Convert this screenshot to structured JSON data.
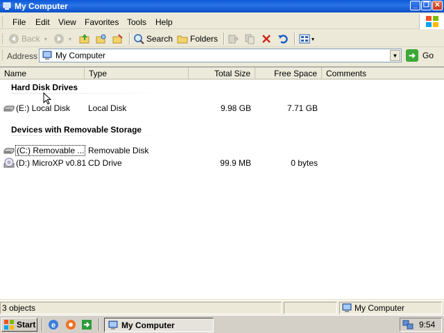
{
  "window": {
    "title": "My Computer",
    "icon": "my-computer-icon",
    "controls": [
      "minimize-icon",
      "restore-icon",
      "close-icon"
    ]
  },
  "menubar": {
    "items": [
      {
        "label": "File"
      },
      {
        "label": "Edit"
      },
      {
        "label": "View"
      },
      {
        "label": "Favorites"
      },
      {
        "label": "Tools"
      },
      {
        "label": "Help"
      }
    ],
    "logo": "windows-flag-icon"
  },
  "toolbar": {
    "back_label": "Back",
    "search_label": "Search",
    "folders_label": "Folders",
    "icons": [
      "back-icon",
      "forward-icon",
      "up-folder-icon",
      "search-icon",
      "folders-icon",
      "move-to-icon",
      "copy-to-icon",
      "delete-icon",
      "undo-icon",
      "views-icon"
    ]
  },
  "address": {
    "label": "Address",
    "value": "My Computer",
    "go_label": "Go"
  },
  "columns": {
    "name": "Name",
    "type": "Type",
    "total_size": "Total Size",
    "free_space": "Free Space",
    "comments": "Comments"
  },
  "groups": [
    {
      "title": "Hard Disk Drives",
      "items": [
        {
          "name": "(E:) Local Disk",
          "type": "Local Disk",
          "total_size": "9.98 GB",
          "free_space": "7.71 GB",
          "icon": "hard-disk-icon"
        }
      ]
    },
    {
      "title": "Devices with Removable Storage",
      "items": [
        {
          "name": "(C:) Removable ...",
          "type": "Removable Disk",
          "total_size": "",
          "free_space": "",
          "icon": "removable-disk-icon"
        },
        {
          "name": "(D:) MicroXP v0.81",
          "type": "CD Drive",
          "total_size": "99.9 MB",
          "free_space": "0 bytes",
          "icon": "cd-drive-icon"
        }
      ]
    }
  ],
  "statusbar": {
    "count": "3 objects",
    "location": "My Computer"
  },
  "taskbar": {
    "start_label": "Start",
    "task_label": "My Computer",
    "clock": "9:54"
  }
}
